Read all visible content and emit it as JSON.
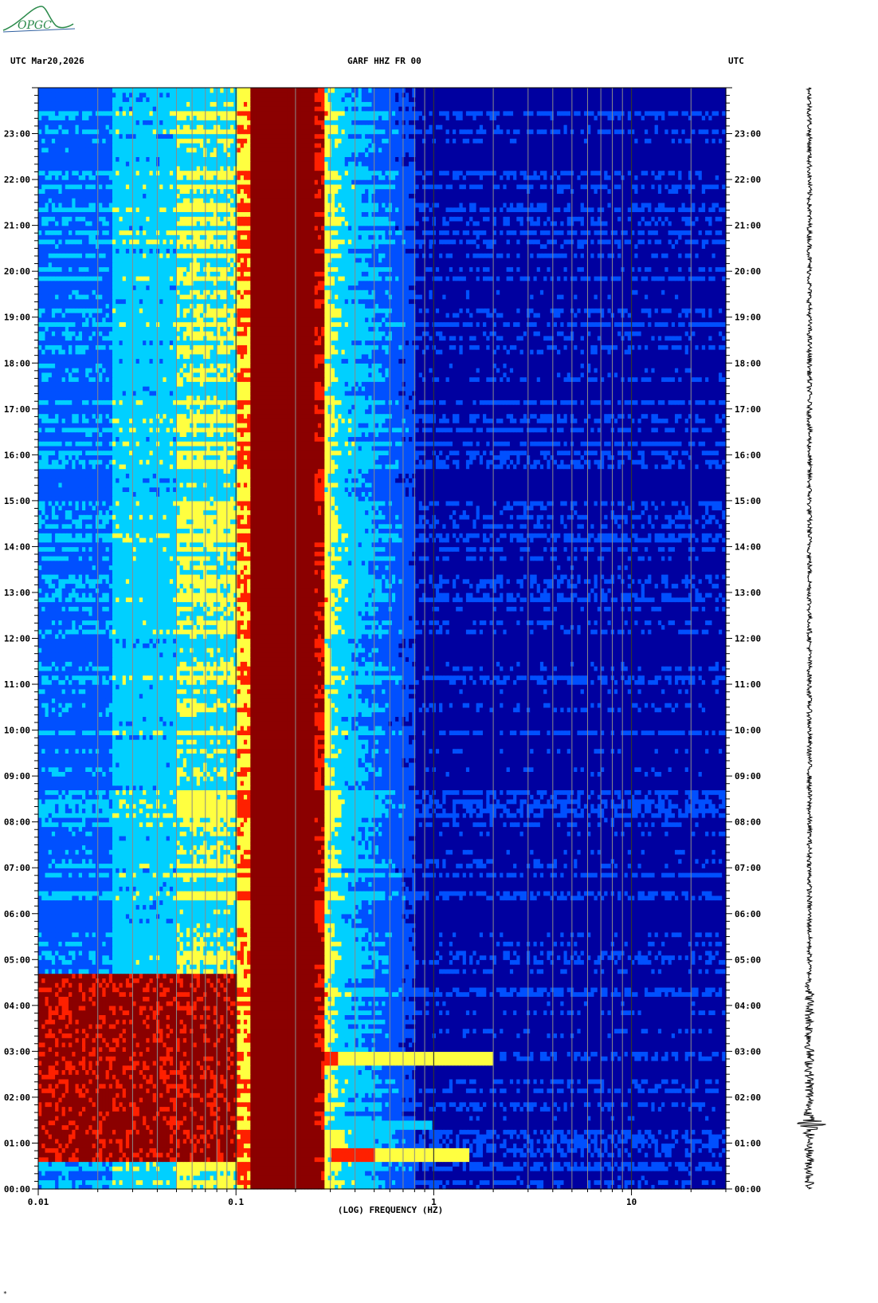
{
  "logo": {
    "text": "OPGC"
  },
  "header": {
    "left": "UTC  Mar20,2026",
    "center": "GARF HHZ FR 00",
    "right": "UTC"
  },
  "chart_data": {
    "type": "heatmap",
    "title": "GARF HHZ FR 00",
    "date": "Mar20,2026",
    "xlabel": "(LOG) FREQUENCY (HZ)",
    "ylabel": "UTC",
    "x_scale": "log",
    "xlim": [
      0.01,
      30
    ],
    "x_ticks": [
      "0.01",
      "0.1",
      "1",
      "10"
    ],
    "y_ticks": [
      "00:00",
      "01:00",
      "02:00",
      "03:00",
      "04:00",
      "05:00",
      "06:00",
      "07:00",
      "08:00",
      "09:00",
      "10:00",
      "11:00",
      "12:00",
      "13:00",
      "14:00",
      "15:00",
      "16:00",
      "17:00",
      "18:00",
      "19:00",
      "20:00",
      "21:00",
      "22:00",
      "23:00"
    ],
    "ylim_hours": [
      0,
      24
    ],
    "colormap": [
      "#0000a0",
      "#0050ff",
      "#00d0ff",
      "#ffff40",
      "#ff2000",
      "#8b0000"
    ],
    "features": [
      {
        "name": "microseism band",
        "freq_range_hz": [
          0.1,
          0.3
        ],
        "level": "max"
      },
      {
        "name": "event",
        "time_utc": "01:25",
        "freq_range_hz": [
          0.01,
          1.0
        ]
      },
      {
        "name": "event",
        "time_utc": "02:50",
        "freq_range_hz": [
          0.2,
          2.0
        ]
      },
      {
        "name": "event",
        "time_utc": "00:45",
        "freq_range_hz": [
          0.3,
          1.5
        ]
      }
    ],
    "seismogram": {
      "peak_time_utc": "01:25"
    }
  },
  "footer": {
    "mark": "*"
  }
}
